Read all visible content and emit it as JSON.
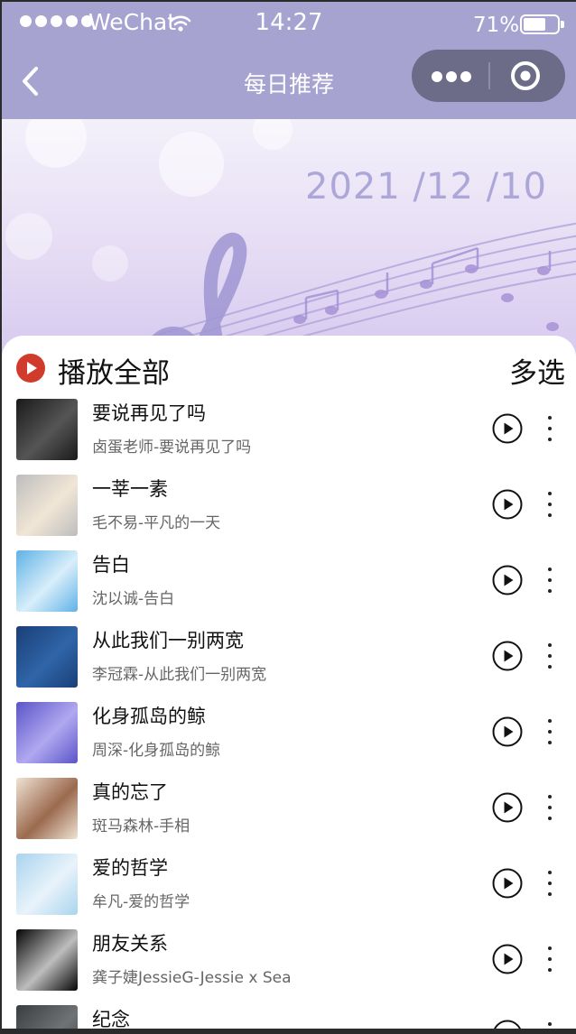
{
  "status_bar": {
    "carrier": "WeChat",
    "time": "14:27",
    "battery_percent": "71%",
    "battery_level": 0.71,
    "signal_bars": 5
  },
  "nav": {
    "title": "每日推荐",
    "back_icon": "chevron-left-icon",
    "more_icon": "more-dots-icon",
    "close_icon": "target-circle-icon"
  },
  "banner": {
    "date": "2021 /12 /10"
  },
  "list_header": {
    "play_all_label": "播放全部",
    "multi_select_label": "多选",
    "play_all_icon_color": "#d03b2c"
  },
  "songs": [
    {
      "title": "要说再见了吗",
      "subtitle": "卤蛋老师-要说再见了吗",
      "cover_colors": [
        "#1a1a1a",
        "#555555"
      ]
    },
    {
      "title": "一莘一素",
      "subtitle": "毛不易-平凡的一天",
      "cover_colors": [
        "#bdbdbd",
        "#f1e6d6"
      ]
    },
    {
      "title": "告白",
      "subtitle": "沈以诚-告白",
      "cover_colors": [
        "#5fb2e6",
        "#d9eefa"
      ]
    },
    {
      "title": "从此我们一别两宽",
      "subtitle": "李冠霖-从此我们一别两宽",
      "cover_colors": [
        "#1a3f78",
        "#2f65a8"
      ]
    },
    {
      "title": "化身孤岛的鲸",
      "subtitle": "周深-化身孤岛的鲸",
      "cover_colors": [
        "#5a55c8",
        "#b1a8f0"
      ]
    },
    {
      "title": "真的忘了",
      "subtitle": "斑马森林-手相",
      "cover_colors": [
        "#efe3d4",
        "#9b6a4e"
      ]
    },
    {
      "title": "爱的哲学",
      "subtitle": "牟凡-爱的哲学",
      "cover_colors": [
        "#a9d4ee",
        "#e8f3fa"
      ]
    },
    {
      "title": "朋友关系",
      "subtitle": "龚子婕JessieG-Jessie x Sea",
      "cover_colors": [
        "#050505",
        "#bdbdbd"
      ]
    },
    {
      "title": "纪念",
      "subtitle": "",
      "cover_colors": [
        "#3a3d3f",
        "#6f7375"
      ]
    }
  ]
}
